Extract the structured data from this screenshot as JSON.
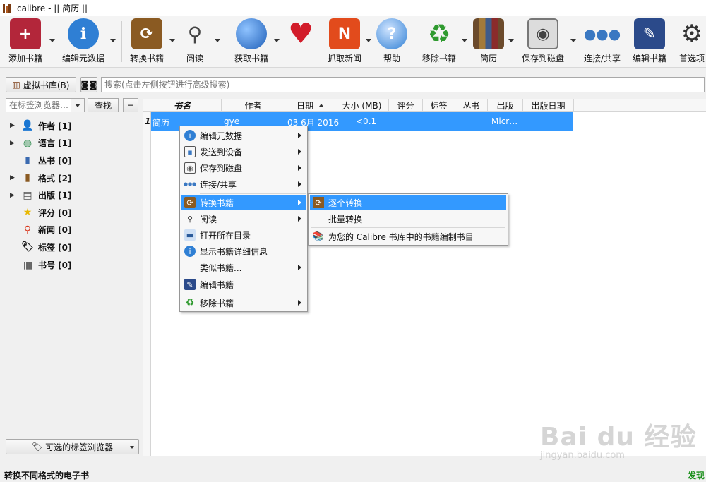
{
  "window": {
    "title": "calibre - || 简历 ||"
  },
  "toolbar": {
    "buttons": [
      {
        "label": "添加书籍",
        "icon": "add-book-icon",
        "color": "#b3263a"
      },
      {
        "label": "编辑元数据",
        "icon": "info-icon",
        "color": "#2f7fd4"
      },
      {
        "label": "转换书籍",
        "icon": "convert-book-icon",
        "color": "#8a5a22"
      },
      {
        "label": "阅读",
        "icon": "magnifier-icon",
        "color": "#777777"
      },
      {
        "label": "获取书籍",
        "icon": "globe-icon",
        "color": "#2a6fc9"
      },
      {
        "label": "",
        "icon": "heart-icon",
        "color": "#d21c2a"
      },
      {
        "label": "抓取新闻",
        "icon": "news-icon",
        "color": "#e24b1c"
      },
      {
        "label": "帮助",
        "icon": "help-icon",
        "color": "#2f7fd4"
      },
      {
        "label": "移除书籍",
        "icon": "recycle-icon",
        "color": "#2f9a2f"
      },
      {
        "label": "简历",
        "icon": "library-icon",
        "color": "#6b4a2b"
      },
      {
        "label": "保存到磁盘",
        "icon": "save-disk-icon",
        "color": "#555555"
      },
      {
        "label": "连接/共享",
        "icon": "connect-share-icon",
        "color": "#3a78c2"
      },
      {
        "label": "编辑书籍",
        "icon": "edit-book-icon",
        "color": "#2b4a8a"
      },
      {
        "label": "首选项",
        "icon": "gear-icon",
        "color": "#333333"
      }
    ]
  },
  "searchbar": {
    "virtual_library_label": "虚拟书库(B)",
    "search_placeholder": "搜索(点击左侧按钮进行高级搜索)"
  },
  "tagbrowser": {
    "search_placeholder": "在标签浏览器…",
    "find_label": "查找",
    "collapse_label": "−",
    "items": [
      {
        "label": "作者 [1]",
        "icon": "author-icon",
        "expandable": true
      },
      {
        "label": "语言 [1]",
        "icon": "language-icon",
        "expandable": true
      },
      {
        "label": "丛书 [0]",
        "icon": "series-icon",
        "expandable": false
      },
      {
        "label": "格式 [2]",
        "icon": "format-icon",
        "expandable": true
      },
      {
        "label": "出版 [1]",
        "icon": "publisher-icon",
        "expandable": true
      },
      {
        "label": "评分 [0]",
        "icon": "star-icon",
        "expandable": false
      },
      {
        "label": "新闻 [0]",
        "icon": "news-pin-icon",
        "expandable": false
      },
      {
        "label": "标签 [0]",
        "icon": "tag-icon",
        "expandable": false
      },
      {
        "label": "书号 [0]",
        "icon": "barcode-icon",
        "expandable": false
      }
    ],
    "optional_browser_label": "可选的标签浏览器"
  },
  "booklist": {
    "columns": [
      "书名",
      "作者",
      "日期",
      "大小 (MB)",
      "评分",
      "标签",
      "丛书",
      "出版",
      "出版日期"
    ],
    "rows": [
      {
        "num": "1",
        "title": "简历",
        "author": "gye",
        "date": "03 6月 2016",
        "size": "<0.1",
        "publisher": "Micr…"
      }
    ]
  },
  "context_menu": {
    "items": [
      {
        "label": "编辑元数据",
        "icon": "info-icon",
        "submenu": true
      },
      {
        "label": "发送到设备",
        "icon": "device-icon",
        "submenu": true
      },
      {
        "label": "保存到磁盘",
        "icon": "save-disk-icon",
        "submenu": true
      },
      {
        "label": "连接/共享",
        "icon": "connect-share-icon",
        "submenu": true
      },
      {
        "label": "转换书籍",
        "icon": "convert-book-icon",
        "submenu": true,
        "highlighted": true
      },
      {
        "label": "阅读",
        "icon": "magnifier-icon",
        "submenu": true
      },
      {
        "label": "打开所在目录",
        "icon": "folder-icon",
        "submenu": false
      },
      {
        "label": "显示书籍详细信息",
        "icon": "info-icon",
        "submenu": false
      },
      {
        "label": "类似书籍...",
        "icon": "",
        "submenu": true
      },
      {
        "label": "编辑书籍",
        "icon": "edit-book-icon",
        "submenu": false
      },
      {
        "label": "移除书籍",
        "icon": "recycle-icon",
        "submenu": true
      }
    ]
  },
  "convert_submenu": {
    "items": [
      {
        "label": "逐个转换",
        "icon": "convert-book-icon",
        "highlighted": true
      },
      {
        "label": "批量转换",
        "icon": ""
      },
      {
        "label": "为您的 Calibre 书库中的书籍编制书目",
        "icon": "catalog-icon"
      }
    ]
  },
  "statusbar": {
    "left": "转换不同格式的电子书",
    "right": "发现"
  },
  "watermark": {
    "main": "Bai du 经验",
    "sub": "jingyan.baidu.com"
  }
}
